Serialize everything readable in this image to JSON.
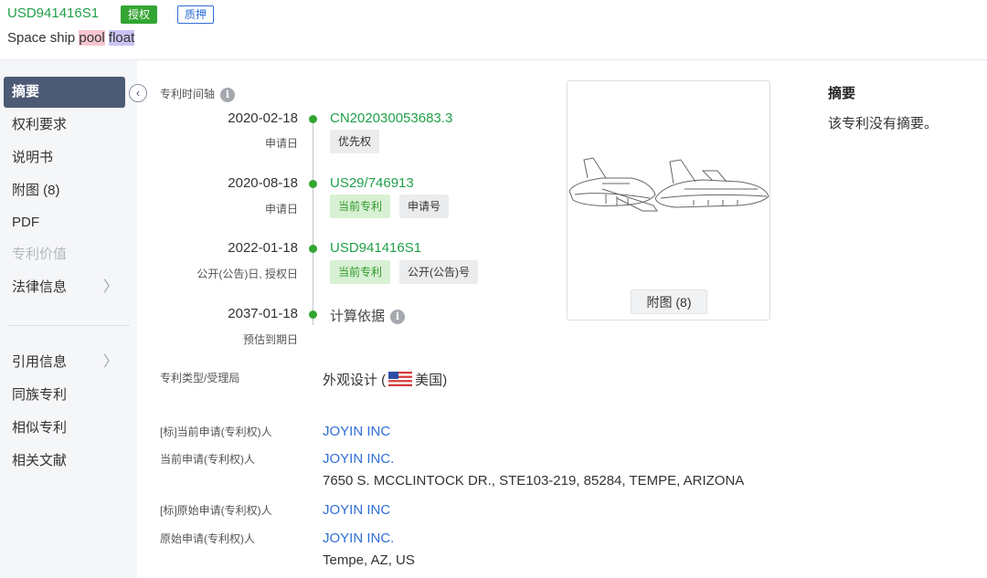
{
  "header": {
    "patent_number": "USD941416S1",
    "tags": [
      "授权",
      "质押"
    ],
    "title_parts": [
      {
        "text": "Space ship ",
        "highlight": "none"
      },
      {
        "text": "pool",
        "highlight": "pink"
      },
      {
        "text": " ",
        "highlight": "none"
      },
      {
        "text": "float",
        "highlight": "purple"
      }
    ]
  },
  "sidebar": {
    "items": [
      {
        "label": "摘要",
        "state": "active"
      },
      {
        "label": "权利要求",
        "state": "normal"
      },
      {
        "label": "说明书",
        "state": "normal"
      },
      {
        "label": "附图 (8)",
        "state": "normal"
      },
      {
        "label": "PDF",
        "state": "normal"
      },
      {
        "label": "专利价值",
        "state": "disabled"
      },
      {
        "label": "法律信息",
        "state": "normal",
        "chevron": "chevron-right-icon"
      },
      {
        "label": "引用信息",
        "state": "normal",
        "chevron": "chevron-right-icon"
      },
      {
        "label": "同族专利",
        "state": "normal"
      },
      {
        "label": "相似专利",
        "state": "normal"
      },
      {
        "label": "相关文献",
        "state": "normal"
      }
    ],
    "chevron_glyph": "〉",
    "collapse_glyph": "‹"
  },
  "timeline": {
    "heading": "专利时间轴",
    "info_glyph": "i",
    "events": [
      {
        "date": "2020-02-18",
        "label": "申请日",
        "number": "CN202030053683.3",
        "chips": [
          {
            "text": "优先权",
            "style": "gray"
          }
        ]
      },
      {
        "date": "2020-08-18",
        "label": "申请日",
        "number": "US29/746913",
        "chips": [
          {
            "text": "当前专利",
            "style": "green"
          },
          {
            "text": "申请号",
            "style": "gray"
          }
        ]
      },
      {
        "date": "2022-01-18",
        "label": "公开(公告)日, 授权日",
        "number": "USD941416S1",
        "chips": [
          {
            "text": "当前专利",
            "style": "green"
          },
          {
            "text": "公开(公告)号",
            "style": "gray"
          }
        ]
      },
      {
        "date": "2037-01-18",
        "label": "预估到期日",
        "calc_text": "计算依据"
      }
    ]
  },
  "figure": {
    "button_label": "附图 (8)"
  },
  "abstract": {
    "title": "摘要",
    "text": "该专利没有摘要。"
  },
  "details": {
    "type_label": "专利类型/受理局",
    "type_value_prefix": "外观设计 (",
    "country": "美国",
    "type_value_suffix": ")",
    "flag_icon": "us-flag-icon",
    "current_std_label": "[标]当前申请(专利权)人",
    "current_std_value": "JOYIN INC",
    "current_label": "当前申请(专利权)人",
    "current_value": "JOYIN INC.",
    "current_address": "7650 S. MCCLINTOCK DR., STE103-219, 85284, TEMPE, ARIZONA",
    "original_std_label": "[标]原始申请(专利权)人",
    "original_std_value": "JOYIN INC",
    "original_label": "原始申请(专利权)人",
    "original_value": "JOYIN INC.",
    "original_address": "Tempe, AZ, US"
  },
  "colors": {
    "accent_green": "#21a04a",
    "link_blue": "#2f6fd6",
    "nav_active": "#4c5a75"
  }
}
